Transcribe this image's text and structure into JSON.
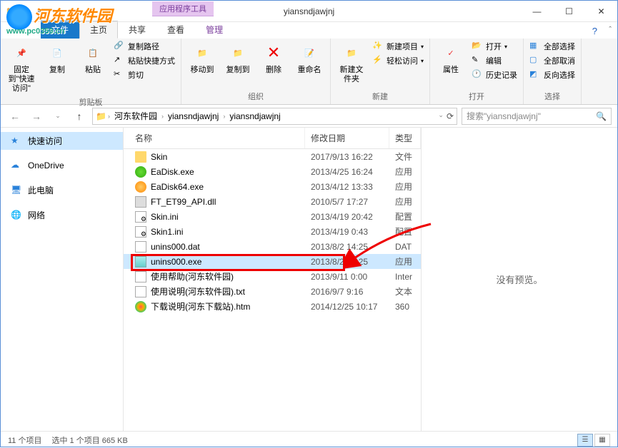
{
  "window": {
    "title": "yiansndjawjnj",
    "context_tab_header": "应用程序工具",
    "tabs": [
      "文件",
      "主页",
      "共享",
      "查看",
      "管理"
    ],
    "active_tab_index": 1
  },
  "watermark": {
    "text": "河东软件园",
    "url": "www.pc0359.cn"
  },
  "ribbon": {
    "pin": "固定到\"快速访问\"",
    "copy": "复制",
    "paste": "粘贴",
    "copy_path": "复制路径",
    "paste_shortcut": "粘贴快捷方式",
    "cut": "剪切",
    "group_clipboard": "剪贴板",
    "move_to": "移动到",
    "copy_to": "复制到",
    "delete": "删除",
    "rename": "重命名",
    "group_organize": "组织",
    "new_folder": "新建文件夹",
    "new_item": "新建项目",
    "easy_access": "轻松访问",
    "group_new": "新建",
    "properties": "属性",
    "open": "打开",
    "edit": "编辑",
    "history": "历史记录",
    "group_open": "打开",
    "select_all": "全部选择",
    "select_none": "全部取消",
    "invert": "反向选择",
    "group_select": "选择"
  },
  "nav": {
    "breadcrumb": [
      "河东软件园",
      "yiansndjawjnj",
      "yiansndjawjnj"
    ],
    "search_placeholder": "搜索\"yiansndjawjnj\""
  },
  "sidebar": {
    "items": [
      {
        "label": "快速访问",
        "icon": "star",
        "active": true
      },
      {
        "label": "OneDrive",
        "icon": "cloud"
      },
      {
        "label": "此电脑",
        "icon": "pc"
      },
      {
        "label": "网络",
        "icon": "network"
      }
    ]
  },
  "columns": {
    "name": "名称",
    "date": "修改日期",
    "type": "类型"
  },
  "files": [
    {
      "name": "Skin",
      "date": "2017/9/13 16:22",
      "type": "文件",
      "icon": "folder"
    },
    {
      "name": "EaDisk.exe",
      "date": "2013/4/25 16:24",
      "type": "应用",
      "icon": "green"
    },
    {
      "name": "EaDisk64.exe",
      "date": "2013/4/12 13:33",
      "type": "应用",
      "icon": "orange"
    },
    {
      "name": "FT_ET99_API.dll",
      "date": "2010/5/7 17:27",
      "type": "应用",
      "icon": "dll"
    },
    {
      "name": "Skin.ini",
      "date": "2013/4/19 20:42",
      "type": "配置",
      "icon": "ini"
    },
    {
      "name": "Skin1.ini",
      "date": "2013/4/19 0:43",
      "type": "配置",
      "icon": "ini"
    },
    {
      "name": "unins000.dat",
      "date": "2013/8/2 14:25",
      "type": "DAT",
      "icon": "dat"
    },
    {
      "name": "unins000.exe",
      "date": "2013/8/2 14:25",
      "type": "应用",
      "icon": "install",
      "selected": true,
      "highlighted": true
    },
    {
      "name": "使用帮助(河东软件园)",
      "date": "2013/9/11 0:00",
      "type": "Inter",
      "icon": "url"
    },
    {
      "name": "使用说明(河东软件园).txt",
      "date": "2016/9/7 9:16",
      "type": "文本",
      "icon": "txt"
    },
    {
      "name": "下载说明(河东下载站).htm",
      "date": "2014/12/25 10:17",
      "type": "360",
      "icon": "htm"
    }
  ],
  "preview": {
    "empty": "没有预览。"
  },
  "status": {
    "count": "11 个项目",
    "selection": "选中 1 个项目  665 KB"
  }
}
